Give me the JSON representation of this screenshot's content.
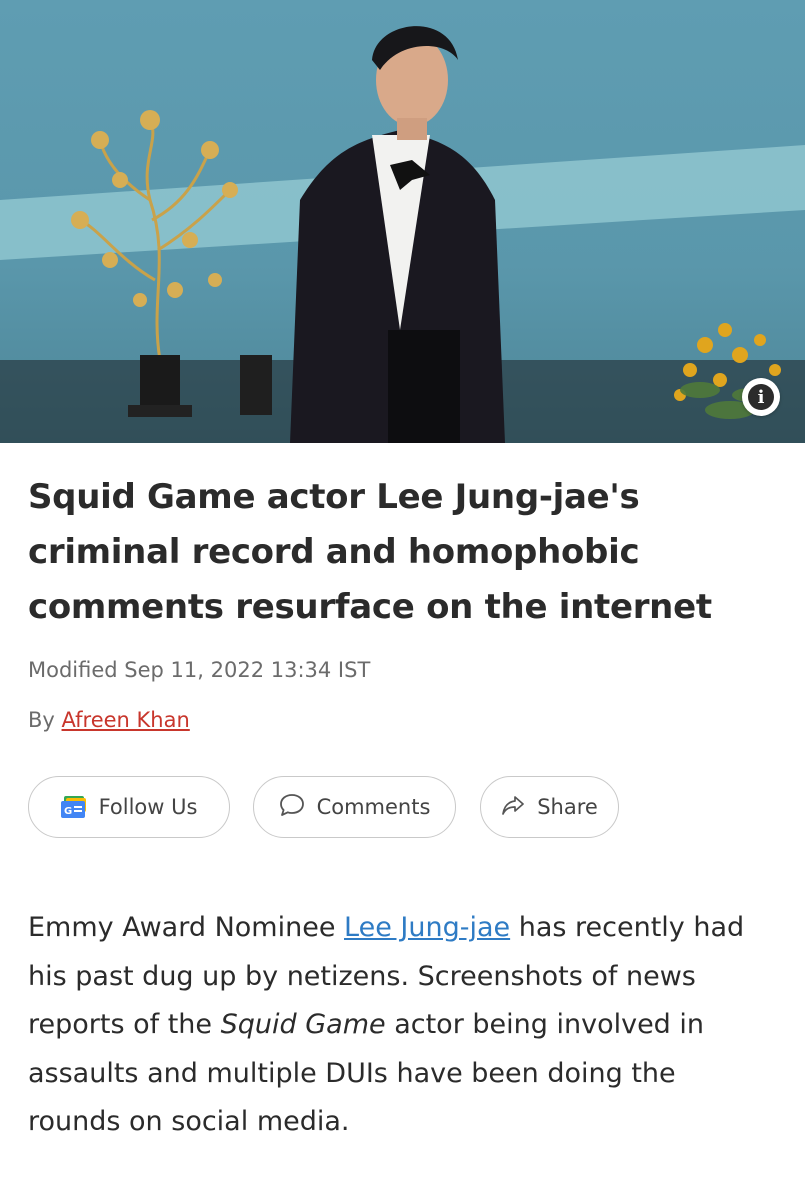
{
  "hero": {
    "info_button_glyph": "i",
    "icon": "info-icon"
  },
  "article": {
    "headline": "Squid Game actor Lee Jung-jae's criminal record and homophobic comments resurface on the internet",
    "modified": "Modified Sep 11, 2022 13:34 IST",
    "byline_prefix": "By",
    "author": "Afreen Khan"
  },
  "actions": {
    "follow_label": "Follow Us",
    "follow_icon": "google-news-icon",
    "comments_label": "Comments",
    "comments_icon": "speech-bubble-icon",
    "share_label": "Share",
    "share_icon": "share-arrow-icon"
  },
  "body": {
    "intro": "Emmy Award Nominee ",
    "link_text": "Lee Jung-jae",
    "after_link": " has recently had his past dug up by netizens. Screenshots of news reports of the ",
    "italic_title": "Squid Game",
    "rest": " actor being involved in assaults and multiple DUIs have been doing the rounds on social media."
  },
  "colors": {
    "author_link": "#c8362c",
    "body_link": "#2e7bc4",
    "text": "#2b2b2b",
    "muted": "#6b6b6b"
  }
}
